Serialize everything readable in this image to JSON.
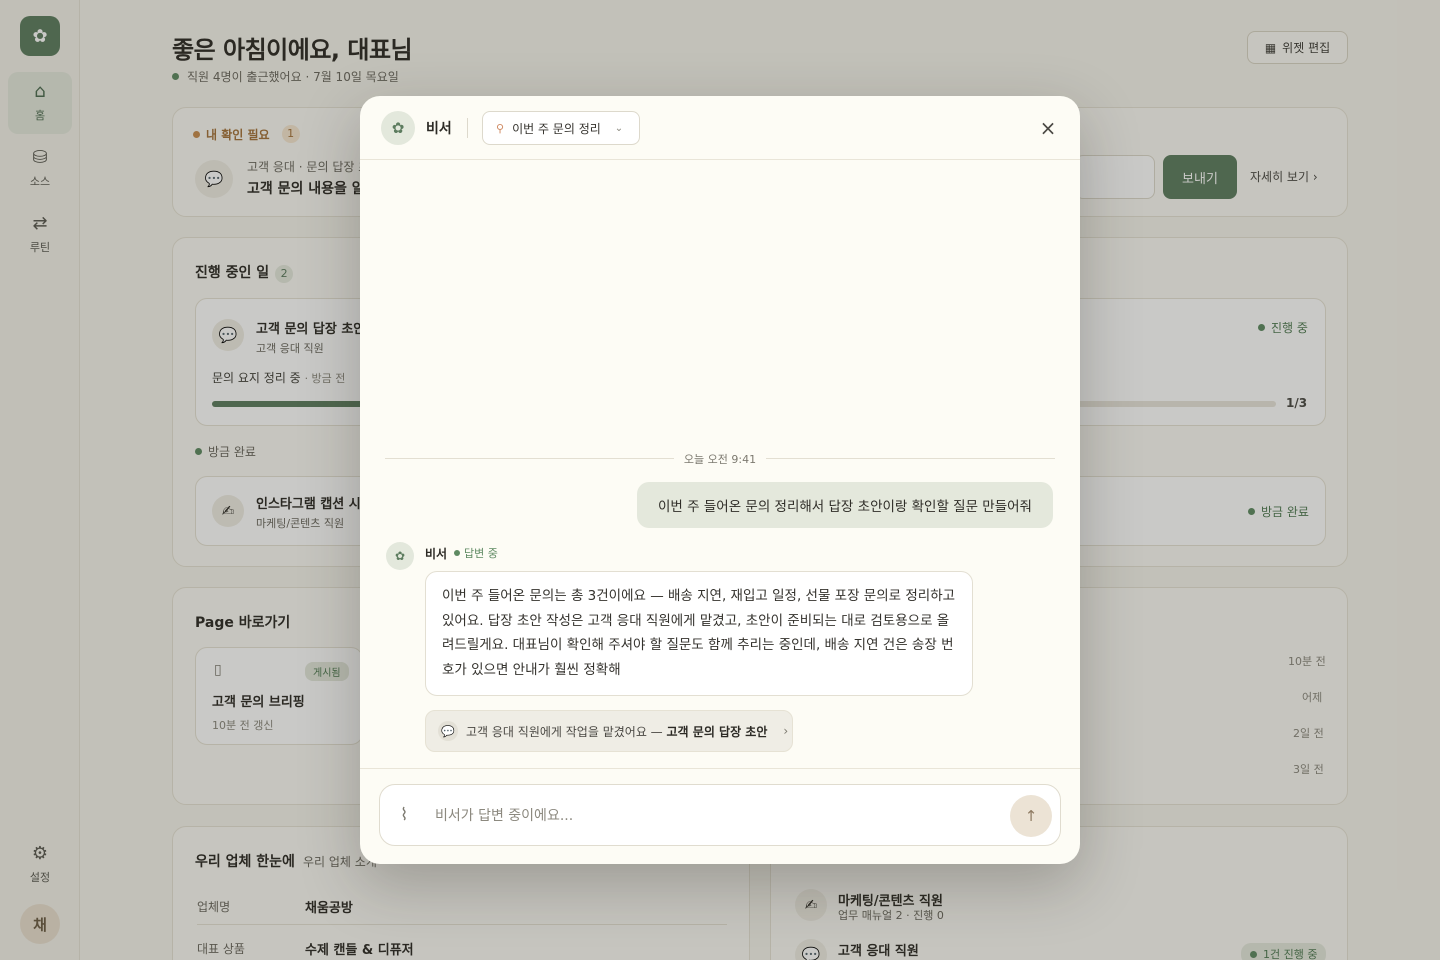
{
  "sidebar": {
    "logo_icon": "sprout-icon",
    "items": [
      {
        "label": "홈",
        "icon": "home-icon"
      },
      {
        "label": "소스",
        "icon": "database-icon"
      },
      {
        "label": "루틴",
        "icon": "repeat-icon"
      }
    ],
    "settings_label": "설정",
    "avatar_initial": "채"
  },
  "header": {
    "title": "좋은 아침이에요, 대표님",
    "subtitle": "직원 4명이 출근했어요 · 7월 10일 목요일",
    "widget_edit_label": "위젯 편집"
  },
  "attention": {
    "title": "내 확인 필요",
    "count": "1",
    "item_meta": "고객 응대 · 문의 답장 초",
    "item_title": "고객 문의 내용을 알",
    "send_label": "보내기",
    "detail_label": "자세히 보기"
  },
  "in_progress": {
    "title": "진행 중인 일",
    "count": "2",
    "task1": {
      "title": "고객 문의 답장 초안",
      "owner": "고객 응대 직원",
      "status_text": "문의 요지 정리 중",
      "status_time": "· 방금 전",
      "badge": "진행 중",
      "progress_label": "1/3",
      "progress": 0.33
    },
    "done_label": "방금 완료",
    "task2": {
      "title": "인스타그램 캡션 시",
      "owner": "마케팅/콘텐츠 직원",
      "badge": "방금 완료"
    }
  },
  "pages": {
    "title": "Page 바로가기",
    "card": {
      "badge": "게시됨",
      "title": "고객 문의 브리핑",
      "meta": "10분 전 갱신"
    },
    "times": [
      "10분 전",
      "어제",
      "2일 전",
      "3일 전"
    ]
  },
  "company": {
    "title": "우리 업체 한눈에",
    "subtitle": "우리 업체 소개",
    "rows": [
      {
        "key": "업체명",
        "value": "채움공방"
      },
      {
        "key": "대표 상품",
        "value": "수제 캔들 & 디퓨저"
      }
    ]
  },
  "staff": {
    "items": [
      {
        "name": "마케팅/콘텐츠 직원",
        "meta": "업무 매뉴얼 2 · 진행 0",
        "icon": "writing-hand-icon"
      },
      {
        "name": "고객 응대 직원",
        "badge": "1건 진행 중",
        "icon": "speech-bubble-icon"
      }
    ]
  },
  "modal": {
    "assistant_name": "비서",
    "topic_label": "이번 주 문의 정리",
    "time_divider": "오늘 오전 9:41",
    "user_message": "이번 주 들어온 문의 정리해서 답장 초안이랑 확인할 질문 만들어줘",
    "bot_name": "비서",
    "bot_status": "답변 중",
    "bot_message": "이번 주 들어온 문의는 총 3건이에요 — 배송 지연, 재입고 일정, 선물 포장 문의로 정리하고 있어요. 답장 초안 작성은 고객 응대 직원에게 맡겼고, 초안이 준비되는 대로 검토용으로 올려드릴게요. 대표님이 확인해 주셔야 할 질문도 함께 추리는 중인데, 배송 지연 건은 송장 번호가 있으면 안내가 훨씬 정확해",
    "handoff_prefix": "고객 응대 직원에게 작업을 맡겼어요 —",
    "handoff_target": "고객 문의 답장 초안",
    "input_placeholder": "비서가 답변 중이에요..."
  },
  "colors": {
    "accent": "#5d7c5f",
    "background": "#f6f4ec",
    "modal": "#fdfcf5"
  }
}
